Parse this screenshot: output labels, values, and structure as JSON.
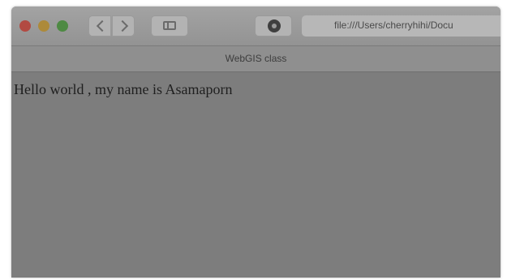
{
  "window": {
    "controls": [
      "close",
      "minimize",
      "zoom"
    ]
  },
  "toolbar": {
    "back_icon": "chevron-left-icon",
    "forward_icon": "chevron-right-icon",
    "sidebar_icon": "sidebar-icon",
    "extension_icon": "extension-icon",
    "address": "file:///Users/cherryhihi/Docu"
  },
  "tab": {
    "title": "WebGIS class"
  },
  "page": {
    "text": "Hello world , my name is Asamaporn"
  },
  "colors": {
    "close": "#b24a42",
    "minimize": "#ad8a3a",
    "zoom": "#4e8a43",
    "page_background": "#7d7d7d"
  }
}
